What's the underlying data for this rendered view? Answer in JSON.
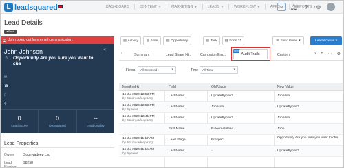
{
  "topnav": {
    "logo_text": "leadsquared",
    "items": [
      {
        "label": "DASHBOARD"
      },
      {
        "label": "CONTENT"
      },
      {
        "label": "MARKETING"
      },
      {
        "label": "LEADS"
      },
      {
        "label": "WORKFLOW"
      },
      {
        "label": "APPS"
      },
      {
        "label": "REPORTS"
      }
    ]
  },
  "header": {
    "title": "Lead Details",
    "back_label": "Back"
  },
  "alert": {
    "text": "John opted out from email communication."
  },
  "lead": {
    "name": "John Johnson",
    "opportunity_text": "Opportunity Are you sure you want to cha",
    "metrics": [
      {
        "value": "0",
        "label": "Lead Score"
      },
      {
        "value": "0",
        "label": "Disengaged"
      },
      {
        "value": "--",
        "label": "Lead Quality"
      }
    ]
  },
  "properties": {
    "title": "Lead Properties",
    "rows": [
      {
        "key": "Owner",
        "value": "Soumyadeep Lsq"
      },
      {
        "key": "Lead Number",
        "value": "98258"
      }
    ]
  },
  "actions": {
    "activity": "Activity",
    "note": "Note",
    "opportunity": "Opportunity",
    "task": "Task",
    "form": "Form 21",
    "send_email": "Send Email",
    "lead_actions": "Lead Actions"
  },
  "tabs": {
    "items": [
      {
        "label": "Summary"
      },
      {
        "label": "Lead Share Hi..."
      },
      {
        "label": "Campaign Em..."
      },
      {
        "label": "Audit Trails"
      },
      {
        "label": "Custom!"
      }
    ],
    "ribbon": "NEW"
  },
  "filters": {
    "fields_label": "Fields",
    "fields_value": "All Selected",
    "time_label": "Time",
    "time_value": "All Time"
  },
  "table": {
    "headers": [
      "Modified",
      "Field",
      "Old Value",
      "New Value"
    ],
    "rows": [
      {
        "date": "15 Jul 2020 12:53 PM",
        "by": "by Soumyadeep Lsq",
        "field": "Last Name",
        "old": "UpdateByrule2",
        "new": "Johnson"
      },
      {
        "date": "15 Jul 2020 12:52 PM",
        "by": "by System",
        "field": "Last Name",
        "old": "Johnson",
        "new": "UpdateByrule2"
      },
      {
        "date": "15 Jul 2020 12:41 PM",
        "by": "by Soumyadeep Lsq",
        "field": "Last Name",
        "old": "UpdateByrule2",
        "new": "Johnson"
      },
      {
        "date": "",
        "by": "",
        "field": "First Name",
        "old": "Rulecreatelead",
        "new": "John"
      },
      {
        "date": "15 Jul 2020 11:17 AM",
        "by": "by Soumyadeep Lsq",
        "field": "Lead Stage",
        "old": "Prospect",
        "new": "Opportunity Are you sure you want to cha"
      },
      {
        "date": "15 Jul 2020 11:15 AM",
        "by": "by System",
        "field": "Last Name",
        "old": "-",
        "new": "UpdateByrule2"
      }
    ]
  },
  "colors": {
    "brand": "#1f79c0",
    "alert_red": "#e04040",
    "card_navy": "#243a53",
    "primary_button": "#2a7ccc",
    "highlight_border": "#e03131"
  }
}
